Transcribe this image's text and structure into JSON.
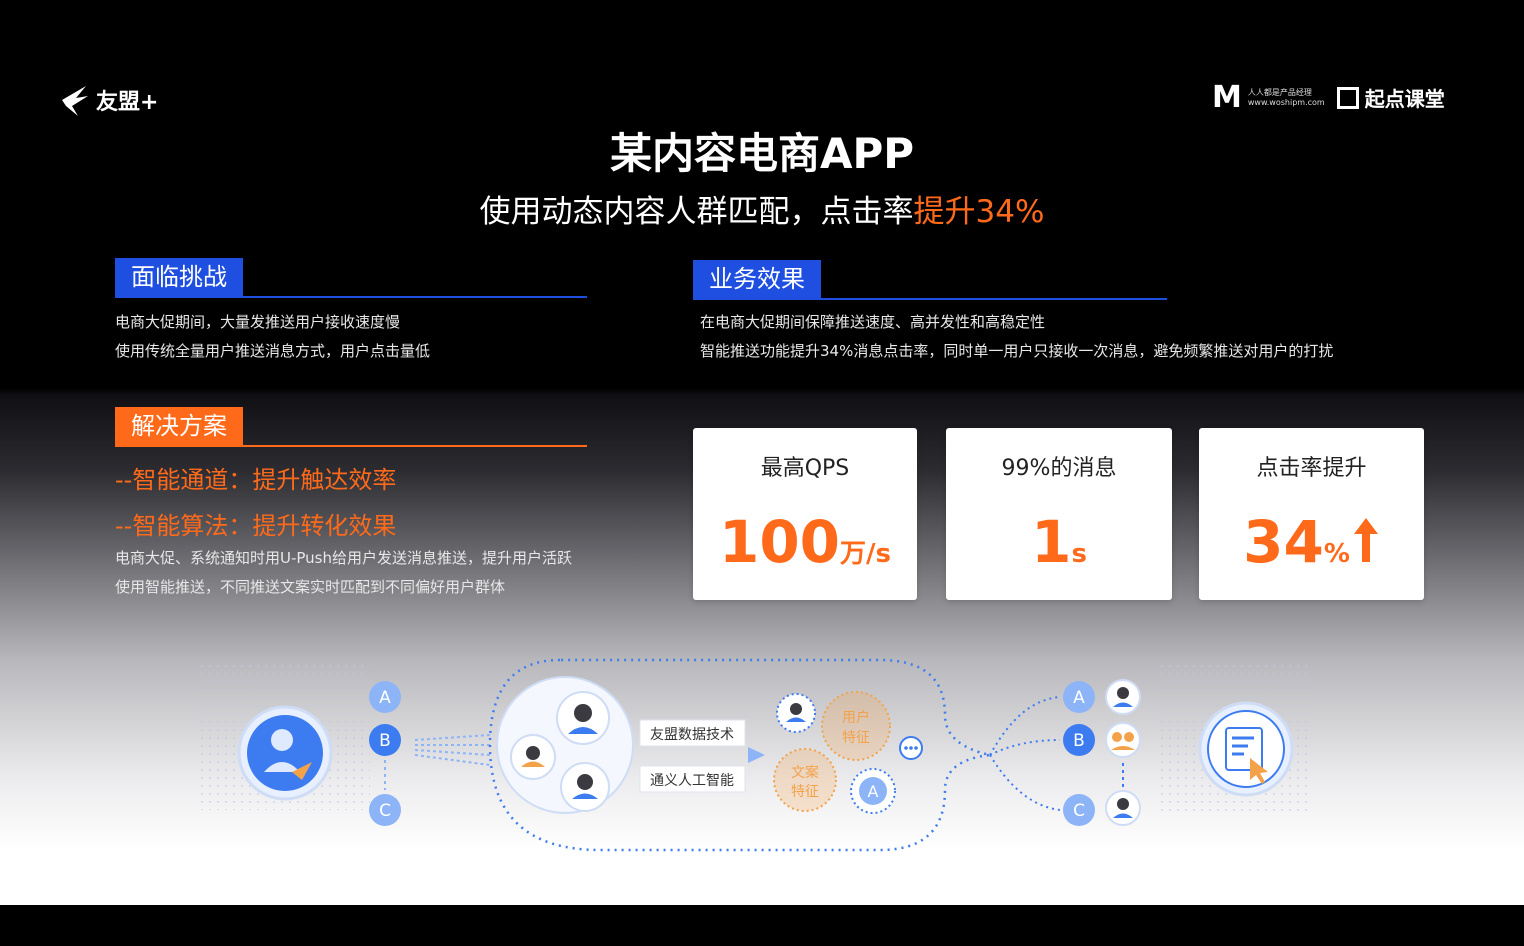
{
  "brand_left": "友盟+",
  "brand_right": {
    "m_text": "人人都是产品经理",
    "m_url": "www.woshipm.com",
    "qd_text": "起点课堂"
  },
  "title": "某内容电商APP",
  "subtitle": {
    "prefix": "使用动态内容人群匹配，点击率",
    "highlight": "提升34%"
  },
  "challenge": {
    "heading": "面临挑战",
    "lines": [
      "电商大促期间，大量发推送用户接收速度慢",
      "使用传统全量用户推送消息方式，用户点击量低"
    ]
  },
  "effect": {
    "heading": "业务效果",
    "lines": [
      "在电商大促期间保障推送速度、高并发性和高稳定性",
      "智能推送功能提升34%消息点击率，同时单一用户只接收一次消息，避免频繁推送对用户的打扰"
    ]
  },
  "solution": {
    "heading": "解决方案",
    "points": [
      "--智能通道：提升触达效率",
      "--智能算法：提升转化效果"
    ],
    "lines": [
      "电商大促、系统通知时用U-Push给用户发送消息推送，提升用户活跃",
      "使用智能推送，不同推送文案实时匹配到不同偏好用户群体"
    ]
  },
  "metrics": [
    {
      "label": "最高QPS",
      "value": "100",
      "unit": "万/s"
    },
    {
      "label": "99%的消息",
      "value": "1",
      "unit": "s"
    },
    {
      "label": "点击率提升",
      "value": "34",
      "unit": "%",
      "arrow": "up"
    }
  ],
  "diagram": {
    "left_badges": [
      "A",
      "B",
      "C"
    ],
    "tech_labels": [
      "友盟数据技术",
      "通义人工智能"
    ],
    "feature_user": "用户特征",
    "feature_copy": "文案特征",
    "feature_badge": "A",
    "right_badges": [
      "A",
      "B",
      "C"
    ],
    "colors": {
      "blue": "#3d7cf0",
      "light_blue": "#8db4f7",
      "orange": "#f4a24a"
    }
  }
}
